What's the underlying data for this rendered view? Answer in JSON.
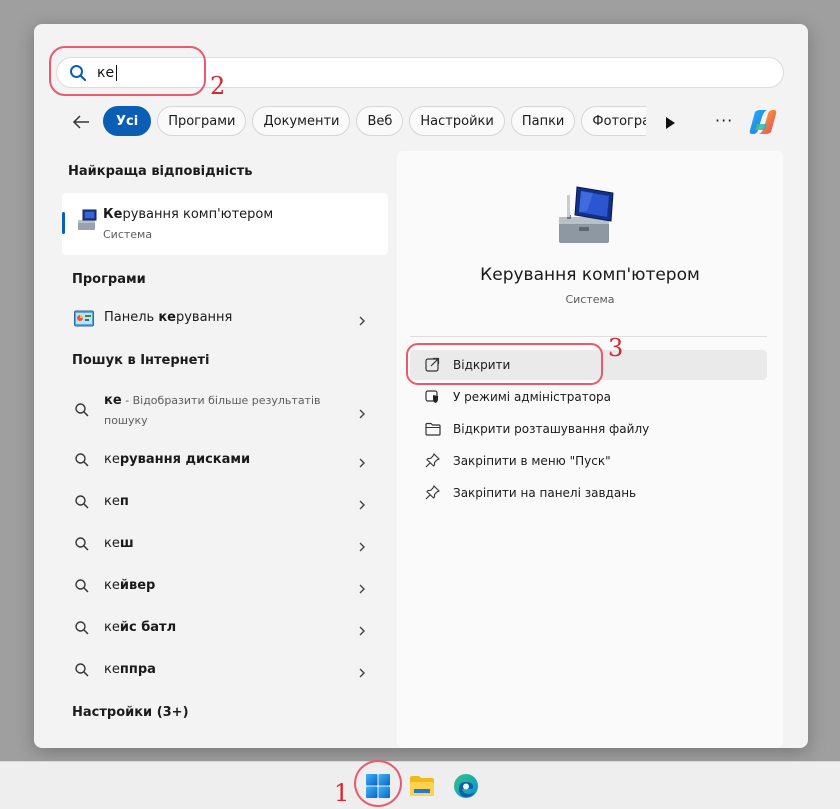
{
  "search": {
    "query": "ке",
    "icon": "search-icon"
  },
  "filters": {
    "back_icon": "back-arrow-icon",
    "chips": [
      "Усі",
      "Програми",
      "Документи",
      "Веб",
      "Настройки",
      "Папки",
      "Фотографії"
    ],
    "active_chip": "Усі",
    "more_label": "···",
    "scroll_icon": "play-right-icon",
    "copilot_icon": "copilot-icon"
  },
  "best_match": {
    "section_title": "Найкраща відповідність",
    "name_bold": "Ке",
    "name_rest": "рування комп'ютером",
    "subtitle": "Система",
    "icon": "computer-management-icon"
  },
  "apps": {
    "section_title": "Програми",
    "items": [
      {
        "pre": "Панель ",
        "bold": "ке",
        "post": "рування",
        "icon": "control-panel-icon"
      }
    ]
  },
  "web": {
    "section_title": "Пошук в Інтернеті",
    "items": [
      {
        "bold": "ке",
        "desc": " - Відобразити більше результатів пошуку"
      },
      {
        "pre": "ке",
        "bold": "рування дисками"
      },
      {
        "pre": "ке",
        "bold": "п"
      },
      {
        "pre": "ке",
        "bold": "ш"
      },
      {
        "pre": "ке",
        "bold": "йвер"
      },
      {
        "pre": "ке",
        "bold": "йс батл"
      },
      {
        "pre": "ке",
        "bold": "ппра"
      }
    ]
  },
  "settings": {
    "section_title": "Настройки (3+)"
  },
  "detail": {
    "title": "Керування комп'ютером",
    "subtitle": "Система",
    "actions": [
      {
        "label": "Відкрити",
        "icon": "open-external-icon"
      },
      {
        "label": "У режимі адміністратора",
        "icon": "admin-shield-icon"
      },
      {
        "label": "Відкрити розташування файлу",
        "icon": "folder-icon"
      },
      {
        "label": "Закріпити в меню \"Пуск\"",
        "icon": "pin-icon"
      },
      {
        "label": "Закріпити на панелі завдань",
        "icon": "pin-icon"
      }
    ]
  },
  "annotations": [
    "1",
    "2",
    "3"
  ],
  "taskbar": {
    "items": [
      "windows-start-icon",
      "file-explorer-icon",
      "edge-browser-icon"
    ]
  },
  "colors": {
    "accent": "#0a5fb4",
    "annotation": "#d7262f"
  }
}
